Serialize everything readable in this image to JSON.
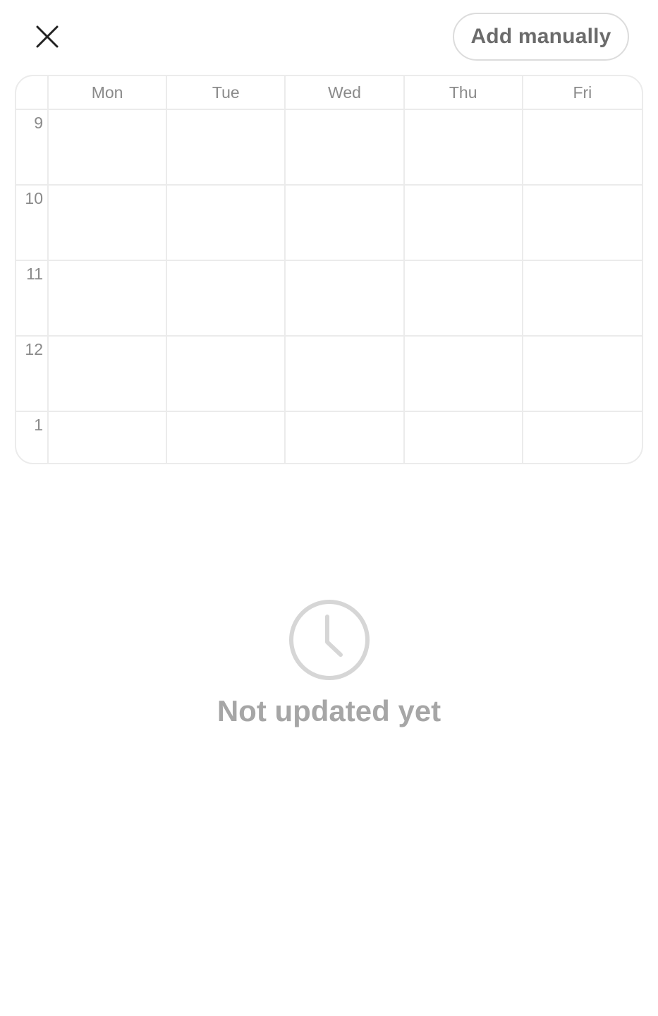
{
  "header": {
    "close_icon": "close-icon",
    "add_label": "Add manually"
  },
  "timetable": {
    "days": [
      "Mon",
      "Tue",
      "Wed",
      "Thu",
      "Fri"
    ],
    "hours": [
      "9",
      "10",
      "11",
      "12",
      "1"
    ]
  },
  "empty_state": {
    "icon": "clock-icon",
    "message": "Not updated yet"
  },
  "colors": {
    "grid_line": "#ebebeb",
    "label_text": "#8a8a8a",
    "empty_text": "#a6a6a6",
    "icon_gray": "#d6d6d6"
  }
}
